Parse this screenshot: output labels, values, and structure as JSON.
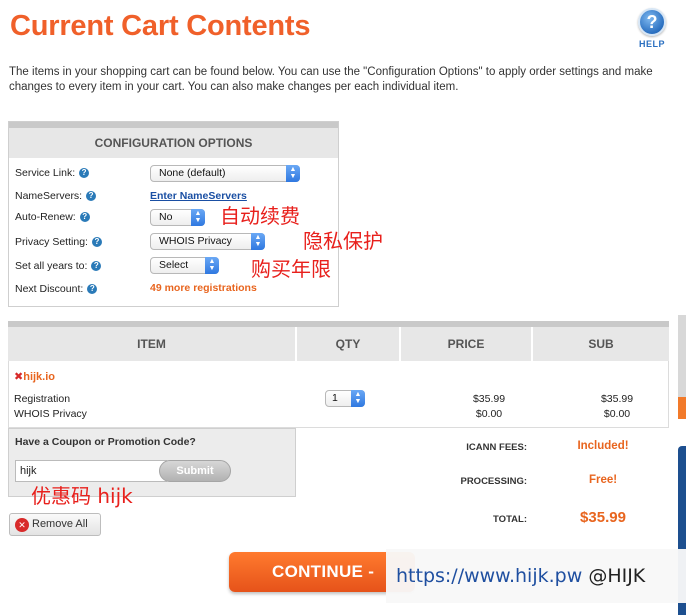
{
  "page": {
    "title": "Current Cart Contents",
    "help_label": "HELP",
    "help_glyph": "?",
    "intro": "The items in your shopping cart can be found below. You can use the \"Configuration Options\" to apply order settings and make changes to every item in your cart. You can also make changes per each individual item."
  },
  "config": {
    "header": "CONFIGURATION OPTIONS",
    "service_link": {
      "label": "Service Link:",
      "value": "None (default)"
    },
    "nameservers": {
      "label": "NameServers:",
      "link": "Enter NameServers"
    },
    "auto_renew": {
      "label": "Auto-Renew:",
      "value": "No"
    },
    "privacy": {
      "label": "Privacy Setting:",
      "value": "WHOIS Privacy"
    },
    "years": {
      "label": "Set all years to:",
      "value": "Select"
    },
    "discount": {
      "label": "Next Discount:",
      "value": "49 more registrations"
    }
  },
  "annotations": {
    "auto_renew": "自动续费",
    "privacy": "隐私保护",
    "years": "购买年限",
    "coupon": "优惠码 hijk"
  },
  "table": {
    "headers": {
      "item": "ITEM",
      "qty": "QTY",
      "price": "PRICE",
      "sub": "SUB"
    },
    "domain": "hijk.io",
    "remove_glyph": "✖",
    "rows": [
      {
        "name": "Registration",
        "qty": "1",
        "price": "$35.99",
        "sub": "$35.99"
      },
      {
        "name": "WHOIS Privacy",
        "price": "$0.00",
        "sub": "$0.00"
      }
    ]
  },
  "coupon": {
    "title": "Have a Coupon or Promotion Code?",
    "value": "hijk",
    "submit": "Submit"
  },
  "totals": {
    "icann_label": "ICANN FEES:",
    "icann_value": "Included!",
    "processing_label": "PROCESSING:",
    "processing_value": "Free!",
    "total_label": "TOTAL:",
    "total_value": "$35.99"
  },
  "actions": {
    "remove_all": "Remove All",
    "continue": "CONTINUE -"
  },
  "watermark": {
    "url": "https://www.hijk.pw",
    "handle": "@HIJK"
  },
  "colors": {
    "accent_orange": "#f0602a",
    "link_blue": "#1a4fa3",
    "annotation_red": "#e8201c"
  }
}
